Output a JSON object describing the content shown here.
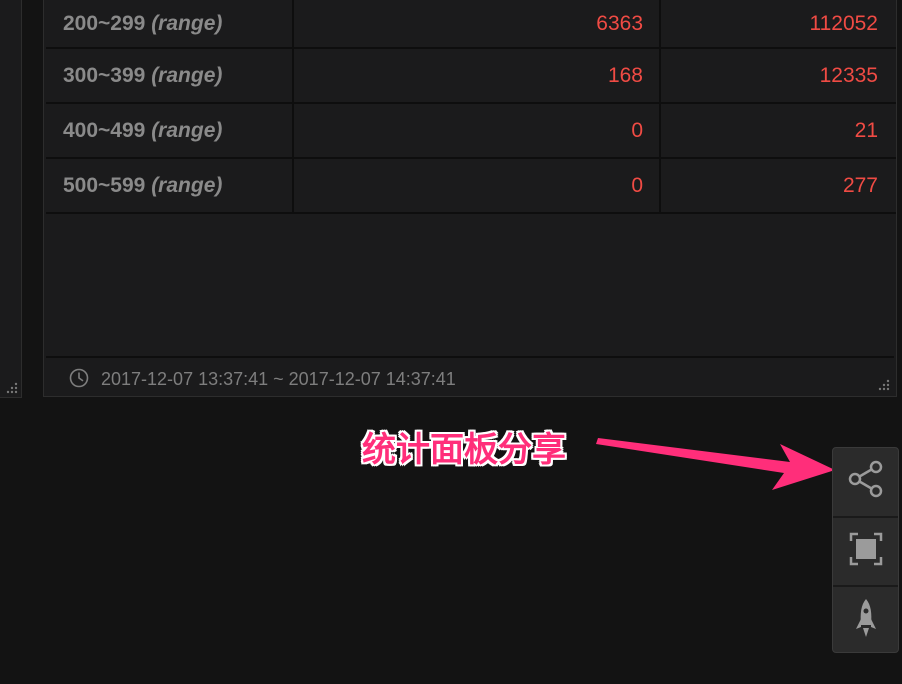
{
  "table": {
    "rows": [
      {
        "range": "200~299",
        "hint": "(range)",
        "v1": "6363",
        "v2": "112052"
      },
      {
        "range": "300~399",
        "hint": "(range)",
        "v1": "168",
        "v2": "12335"
      },
      {
        "range": "400~499",
        "hint": "(range)",
        "v1": "0",
        "v2": "21"
      },
      {
        "range": "500~599",
        "hint": "(range)",
        "v1": "0",
        "v2": "277"
      }
    ]
  },
  "footer": {
    "time_range": "2017-12-07 13:37:41 ~ 2017-12-07 14:37:41",
    "icon": "clock-icon"
  },
  "annotation": {
    "label": "统计面板分享",
    "color": "#ff2e7a"
  },
  "toolbar": {
    "buttons": [
      {
        "icon": "share-icon"
      },
      {
        "icon": "fullscreen-icon"
      },
      {
        "icon": "rocket-icon"
      }
    ]
  },
  "colors": {
    "value": "#f04b44",
    "label": "#8a8a8a",
    "background": "#131313",
    "panel": "#1b1b1c"
  }
}
